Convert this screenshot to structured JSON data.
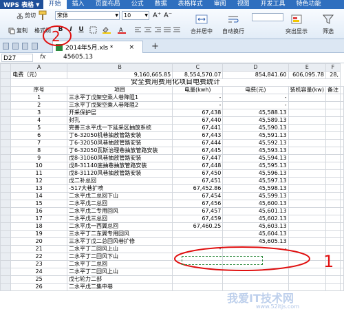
{
  "menu": {
    "app_label": "WPS 表格",
    "items": [
      "开始",
      "插入",
      "页面布局",
      "公式",
      "数据",
      "表格样式",
      "审阅",
      "视图",
      "开发工具",
      "特色功能"
    ],
    "active_index": 0
  },
  "ribbon": {
    "cut": "剪切",
    "copy": "复制",
    "format_painter": "格式刷",
    "font_name": "宋体",
    "font_size": "10",
    "bold": "B",
    "italic": "I",
    "underline": "U",
    "merge_center": "合并居中",
    "wrap_text": "自动换行",
    "highlight": "突出显示",
    "filter": "筛选"
  },
  "tabs": {
    "document": "2014年5月.xls *",
    "new_tab": "+"
  },
  "formula_bar": {
    "cell_ref": "D27",
    "fx": "fx",
    "value": "45605.13"
  },
  "sheet": {
    "columns": [
      "A",
      "B",
      "C",
      "D",
      "E",
      "F"
    ],
    "row1": [
      "电费（元）",
      "9,160,665.85",
      "8,554,570.07",
      "854,841.60",
      "606,095.78",
      "28,"
    ],
    "title": "安全费用费用化项目电费统计",
    "header": [
      "序号",
      "项目",
      "电量(kwh)",
      "电费(元)",
      "装机容量(kw)",
      "备注"
    ],
    "rows": [
      [
        "1",
        "三水平丁戊架空乘人巷降阻1",
        "-",
        "-",
        ""
      ],
      [
        "2",
        "三水平丁戊架空乘人巷降阻2",
        "-",
        "-",
        ""
      ],
      [
        "3",
        "开采保护层",
        "67,438",
        "45,588.13",
        ""
      ],
      [
        "4",
        "封孔",
        "67,440",
        "45,589.13",
        ""
      ],
      [
        "5",
        "完善三水平戊一下延采区抽放系统",
        "67,441",
        "45,590.13",
        ""
      ],
      [
        "6",
        "丁6-32050机巷抽放管路安装",
        "67,443",
        "45,591.13",
        ""
      ],
      [
        "7",
        "丁6-32050风巷抽放管路安装",
        "67,444",
        "45,592.13",
        ""
      ],
      [
        "8",
        "丁6-32050瓦斯治理巷抽放管路安装",
        "67,445",
        "45,593.13",
        ""
      ],
      [
        "9",
        "戊8-31060风巷抽放管路安装",
        "67,447",
        "45,594.13",
        ""
      ],
      [
        "10",
        "戊8-31140底抽巷抽放管路安装",
        "67,448",
        "45,595.13",
        ""
      ],
      [
        "11",
        "戊8-31120风巷抽放管路安装",
        "67,450",
        "45,596.13",
        ""
      ],
      [
        "12",
        "戊二补总回",
        "67,451",
        "45,597.13",
        ""
      ],
      [
        "13",
        "-517大巷扩喷",
        "67,452.86",
        "45,598.13",
        ""
      ],
      [
        "14",
        "二水平戊二总回下山",
        "67,454",
        "45,599.13",
        ""
      ],
      [
        "15",
        "二水平戊二总回",
        "67,456",
        "45,600.13",
        ""
      ],
      [
        "16",
        "二水平戊二专用回风",
        "67,457",
        "45,601.13",
        ""
      ],
      [
        "17",
        "二水平戊三总回",
        "67,459",
        "45,602.13",
        ""
      ],
      [
        "18",
        "二水平戊一西翼总回",
        "67,460.25",
        "45,603.13",
        ""
      ],
      [
        "19",
        "三水平丁二东翼专用回风",
        "",
        "45,604.13",
        ""
      ],
      [
        "20",
        "三水平丁戊二总回风巷扩修",
        "",
        "45,605.13",
        ""
      ],
      [
        "21",
        "二水平丁二回风上山",
        "-",
        "-",
        ""
      ],
      [
        "22",
        "二水平丁二回风下山",
        "-",
        "",
        ""
      ],
      [
        "23",
        "二水平丁二总回",
        "",
        "",
        ""
      ],
      [
        "24",
        "二水平丁二回风上山",
        "",
        "",
        ""
      ],
      [
        "25",
        "戊七轮力二部",
        "",
        "",
        ""
      ],
      [
        "26",
        "二水平戊二集中巷",
        "",
        "",
        ""
      ]
    ]
  },
  "annotations": {
    "circle_2": "2",
    "circle_1": "1"
  },
  "watermark": {
    "main": "我爱IT技术网",
    "sub": "www.52itjs.com"
  }
}
